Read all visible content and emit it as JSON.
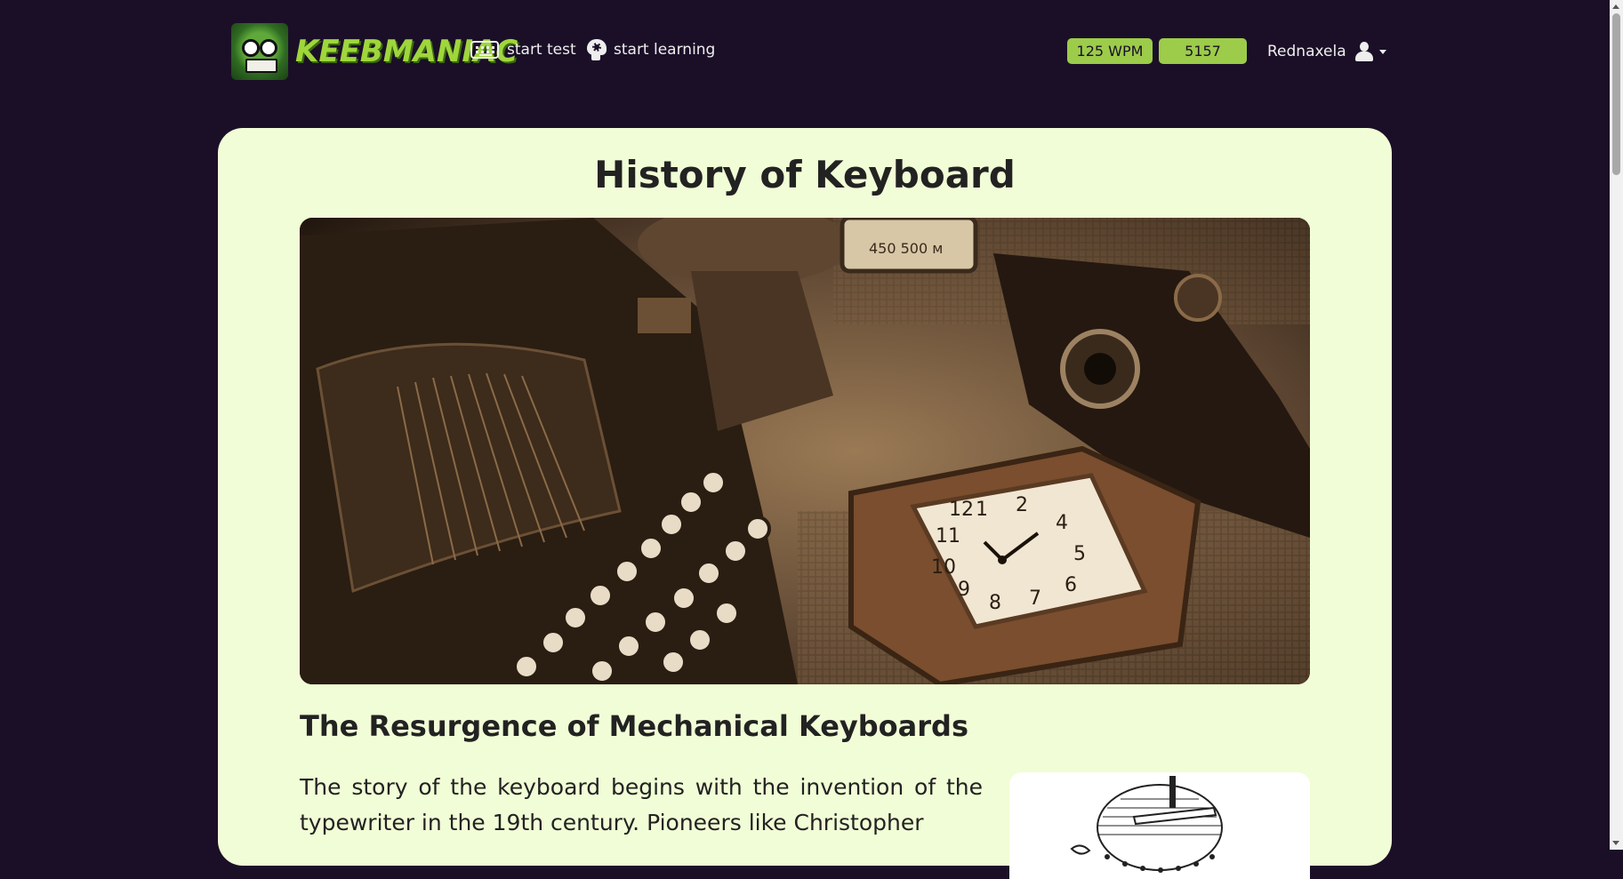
{
  "header": {
    "logo_text": "KEEBMANIAC",
    "nav": {
      "start_test": "start test",
      "start_learning": "start learning"
    },
    "badges": {
      "wpm": "125 WPM",
      "tests": "5157 tests"
    },
    "user": {
      "name": "Rednaxela"
    }
  },
  "main": {
    "title": "History of Keyboard",
    "hero_image": "vintage-typewriter-camera-clock-photo",
    "section_title": "The Resurgence of Mechanical Keyboards",
    "paragraph": "The story of the keyboard begins with the invention of the typewriter in the 19th century. Pioneers like Christopher",
    "side_image": "antique-typewriter-engraving"
  },
  "colors": {
    "background": "#1b0f28",
    "card": "#f1fdd6",
    "badge": "#9ccc4a",
    "logo": "#9fd63c"
  }
}
